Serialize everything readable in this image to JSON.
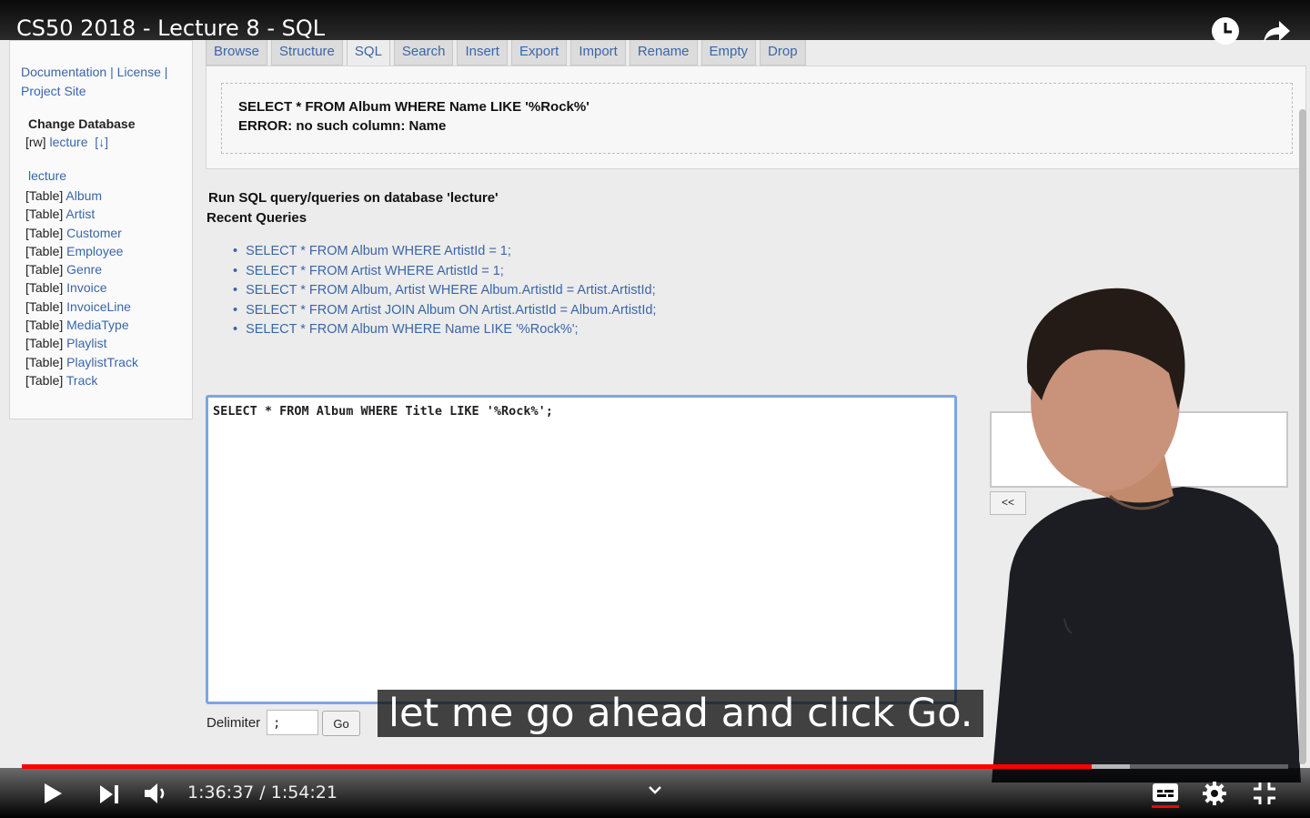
{
  "player": {
    "title": "CS50 2018 - Lecture 8 - SQL",
    "subtitle": "let me go ahead and click Go.",
    "time": "1:36:37 / 1:54:21",
    "progress": 0.845,
    "buffered": 0.875
  },
  "sidebar": {
    "links": [
      "Documentation",
      "License",
      "Project Site"
    ],
    "change_db_label": "Change Database",
    "rw_prefix": "[rw]",
    "rw_db": "lecture",
    "rw_download": "[↓]",
    "db_name": "lecture",
    "table_prefix": "[Table]",
    "tables": [
      "Album",
      "Artist",
      "Customer",
      "Employee",
      "Genre",
      "Invoice",
      "InvoiceLine",
      "MediaType",
      "Playlist",
      "PlaylistTrack",
      "Track"
    ]
  },
  "tabs": [
    "Browse",
    "Structure",
    "SQL",
    "Search",
    "Insert",
    "Export",
    "Import",
    "Rename",
    "Empty",
    "Drop"
  ],
  "active_tab": "SQL",
  "error": {
    "query": "SELECT * FROM Album WHERE Name LIKE '%Rock%'",
    "message": "ERROR: no such column: Name"
  },
  "run_title": "Run SQL query/queries on database 'lecture'",
  "recent_title": "Recent Queries",
  "recent_queries": [
    "SELECT * FROM Album WHERE ArtistId = 1;",
    "SELECT * FROM Artist WHERE ArtistId = 1;",
    "SELECT * FROM Album, Artist WHERE Album.ArtistId = Artist.ArtistId;",
    "SELECT * FROM Artist JOIN Album ON Artist.ArtistId = Album.ArtistId;",
    "SELECT * FROM Album WHERE Name LIKE '%Rock%';"
  ],
  "query_text": "SELECT * FROM Album WHERE Title LIKE '%Rock%';",
  "delimiter_label": "Delimiter",
  "delimiter_value": ";",
  "go_label": "Go",
  "side_button": "<<",
  "colors": {
    "link": "#3a66a8",
    "progress": "#ff0000",
    "focus_border": "#7aa7e0"
  },
  "icons": [
    "clock-icon",
    "share-icon",
    "play-icon",
    "next-icon",
    "volume-icon",
    "chevron-down-icon",
    "captions-icon",
    "settings-icon",
    "exit-fullscreen-icon"
  ]
}
